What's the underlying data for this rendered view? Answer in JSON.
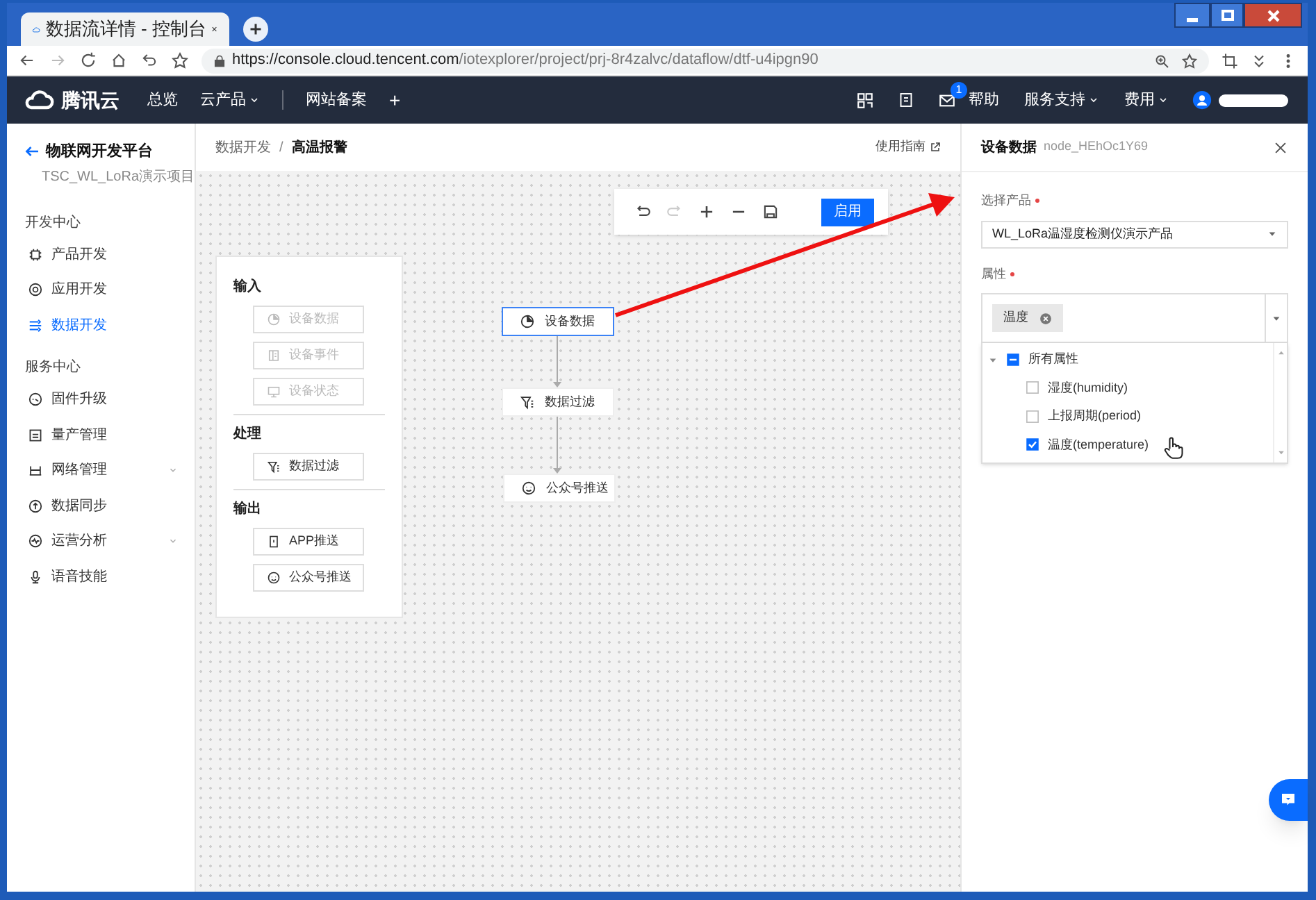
{
  "browser": {
    "tab_title": "数据流详情 - 控制台",
    "url_host": "https://console.cloud.tencent.com",
    "url_path": "/iotexplorer/project/prj-8r4zalvc/dataflow/dtf-u4ipgn90"
  },
  "topnav": {
    "logo": "腾讯云",
    "items": [
      {
        "label": "总览",
        "dropdown": false
      },
      {
        "label": "云产品",
        "dropdown": true
      },
      {
        "label": "网站备案",
        "dropdown": false
      }
    ],
    "add": "+",
    "mail_badge": "1",
    "right_items": [
      {
        "label": "帮助",
        "dropdown": false
      },
      {
        "label": "服务支持",
        "dropdown": true
      },
      {
        "label": "费用",
        "dropdown": true
      }
    ]
  },
  "sidebar": {
    "title": "物联网开发平台",
    "project": "TSC_WL_LoRa演示项目",
    "sections": [
      {
        "title": "开发中心",
        "items": [
          {
            "label": "产品开发",
            "selected": false,
            "expandable": false
          },
          {
            "label": "应用开发",
            "selected": false,
            "expandable": false
          },
          {
            "label": "数据开发",
            "selected": true,
            "expandable": false
          }
        ]
      },
      {
        "title": "服务中心",
        "items": [
          {
            "label": "固件升级",
            "selected": false,
            "expandable": false
          },
          {
            "label": "量产管理",
            "selected": false,
            "expandable": false
          },
          {
            "label": "网络管理",
            "selected": false,
            "expandable": true
          },
          {
            "label": "数据同步",
            "selected": false,
            "expandable": false
          },
          {
            "label": "运营分析",
            "selected": false,
            "expandable": true
          },
          {
            "label": "语音技能",
            "selected": false,
            "expandable": false
          }
        ]
      }
    ]
  },
  "breadcrumb": {
    "items": [
      "数据开发",
      "高温报警"
    ],
    "separator": "/"
  },
  "guide_link": "使用指南",
  "toolbar": {
    "tools": [
      {
        "disabled": false
      },
      {
        "disabled": true
      },
      {
        "disabled": false
      },
      {
        "disabled": false
      },
      {
        "disabled": false
      }
    ],
    "enable_button": "启用"
  },
  "palette": [
    {
      "title": "输入",
      "items": [
        {
          "label": "设备数据",
          "disabled": true
        },
        {
          "label": "设备事件",
          "disabled": true
        },
        {
          "label": "设备状态",
          "disabled": true
        }
      ]
    },
    {
      "title": "处理",
      "items": [
        {
          "label": "数据过滤",
          "disabled": false
        }
      ]
    },
    {
      "title": "输出",
      "items": [
        {
          "label": "APP推送",
          "disabled": false
        },
        {
          "label": "公众号推送",
          "disabled": false
        }
      ]
    }
  ],
  "flow_nodes": [
    {
      "label": "设备数据",
      "selected": true
    },
    {
      "label": "数据过滤",
      "selected": false
    },
    {
      "label": "公众号推送",
      "selected": false
    }
  ],
  "panel": {
    "title": "设备数据",
    "node_id": "node_HEhOc1Y69",
    "product_label": "选择产品",
    "product_required": true,
    "product_value": "WL_LoRa温湿度检测仪演示产品",
    "attr_label": "属性",
    "attr_required": true,
    "tags": [
      "温度"
    ],
    "tree": {
      "label": "所有属性",
      "expanded": true,
      "indeterminate": true,
      "children": [
        {
          "label": "湿度(humidity)",
          "checked": false
        },
        {
          "label": "上报周期(period)",
          "checked": false
        },
        {
          "label": "温度(temperature)",
          "checked": true
        }
      ]
    }
  }
}
